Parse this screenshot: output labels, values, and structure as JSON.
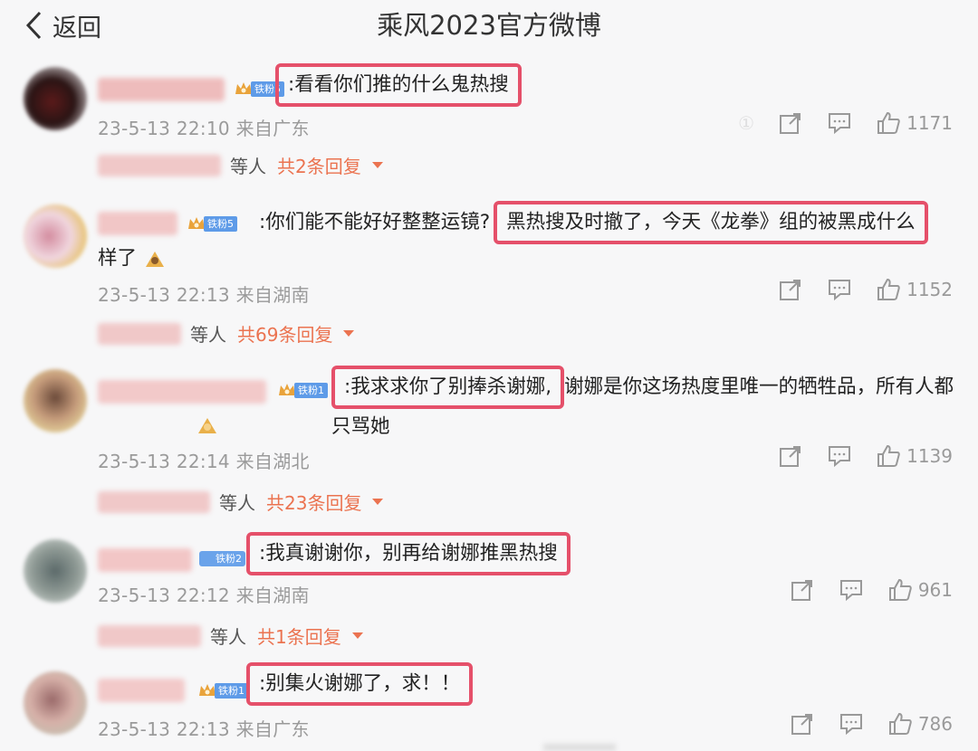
{
  "header": {
    "back_label": "返回",
    "title": "乘风2023官方微博"
  },
  "comments": [
    {
      "fan_badge": "铁粉5",
      "pre": "",
      "highlight": ":看看你们推的什么鬼热搜",
      "post": "",
      "timestamp": "23-5-13 22:10 来自广东",
      "likes": "1171",
      "reply_deng": "等人",
      "reply_count": "共2条回复"
    },
    {
      "fan_badge": "铁粉5",
      "pre": ":你们能不能好好整整运镜?",
      "highlight": "黑热搜及时撤了，今天《龙拳》组的被黑成什么",
      "post": "样了",
      "timestamp": "23-5-13 22:13 来自湖南",
      "likes": "1152",
      "reply_deng": "等人",
      "reply_count": "共69条回复"
    },
    {
      "fan_badge": "铁粉1",
      "pre": "",
      "highlight": ":我求求你了别捧杀谢娜,",
      "post": "谢娜是你这场热度里唯一的牺牲品，所有人都只骂她",
      "timestamp": "23-5-13 22:14 来自湖北",
      "likes": "1139",
      "reply_deng": "等人",
      "reply_count": "共23条回复"
    },
    {
      "fan_badge": "铁粉2",
      "pre": "",
      "highlight": ":我真谢谢你，别再给谢娜推黑热搜",
      "post": "",
      "timestamp": "23-5-13 22:12 来自湖南",
      "likes": "961",
      "reply_deng": "等人",
      "reply_count": "共1条回复"
    },
    {
      "fan_badge": "铁粉1",
      "pre": "",
      "highlight": ":别集火谢娜了，求！！",
      "post": "",
      "timestamp": "23-5-13 22:13 来自广东",
      "likes": "786"
    }
  ],
  "colors": {
    "highlight_border": "#e5506a",
    "reply_link": "#eb7350",
    "fan_badge": "#5e9be8",
    "meta_text": "#9a9a9a",
    "background": "#f7f7f8"
  },
  "icons": [
    "back-chevron-icon",
    "crown-icon",
    "share-icon",
    "comment-icon",
    "like-icon",
    "caret-down-icon",
    "emoji-icon"
  ]
}
